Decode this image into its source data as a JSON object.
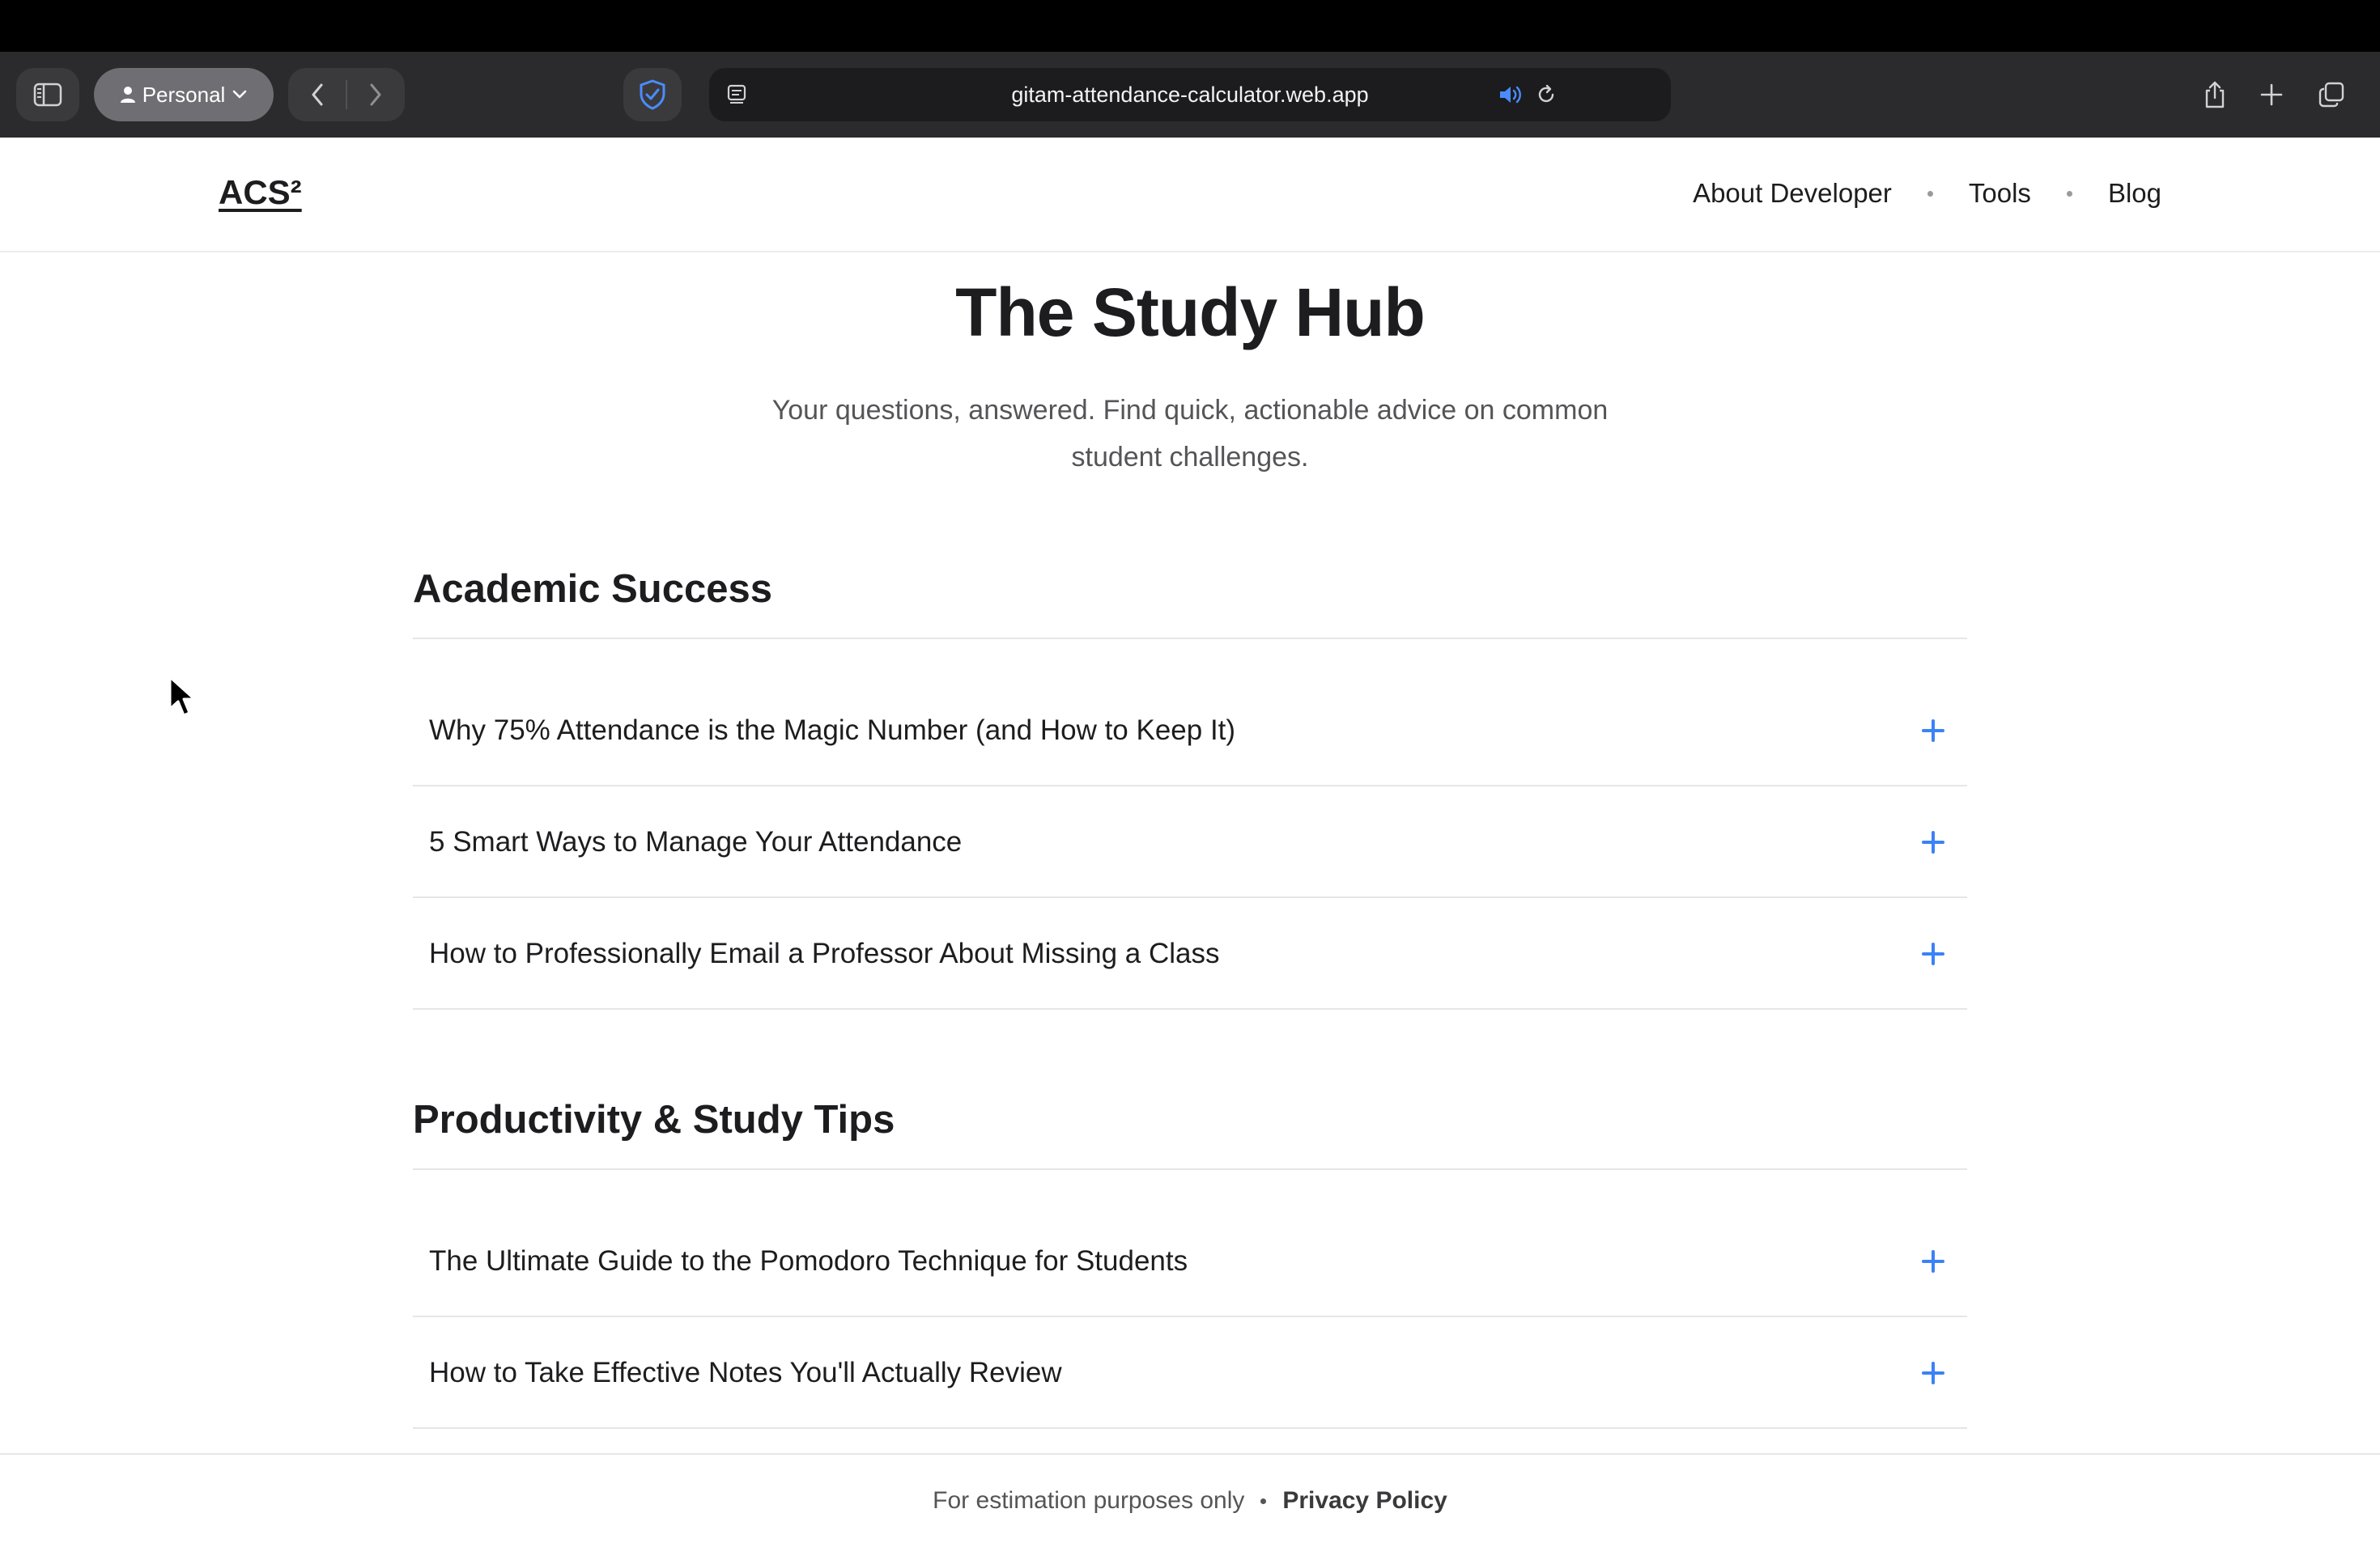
{
  "browser": {
    "profile_label": "Personal",
    "url": "gitam-attendance-calculator.web.app",
    "icons": [
      "sidebar-icon",
      "person-icon",
      "chevron-down-icon",
      "back-icon",
      "forward-icon",
      "shield-icon",
      "reader-icon",
      "audio-icon",
      "reload-icon",
      "share-icon",
      "new-tab-icon",
      "tab-overview-icon"
    ],
    "accent_color": "#3b82f6"
  },
  "site": {
    "logo": "ACS²",
    "nav": [
      {
        "label": "About Developer"
      },
      {
        "label": "Tools"
      },
      {
        "label": "Blog"
      }
    ]
  },
  "hero": {
    "title": "The Study Hub",
    "subtitle_line1": "Your questions, answered. Find quick, actionable advice on common",
    "subtitle_line2": "student challenges."
  },
  "sections": [
    {
      "title": "Academic Success",
      "items": [
        {
          "question": "Why 75% Attendance is the Magic Number (and How to Keep It)"
        },
        {
          "question": "5 Smart Ways to Manage Your Attendance"
        },
        {
          "question": "How to Professionally Email a Professor About Missing a Class"
        }
      ]
    },
    {
      "title": "Productivity & Study Tips",
      "items": [
        {
          "question": "The Ultimate Guide to the Pomodoro Technique for Students"
        },
        {
          "question": "How to Take Effective Notes You'll Actually Review"
        }
      ]
    }
  ],
  "footer": {
    "disclaimer": "For estimation purposes only",
    "privacy_label": "Privacy Policy"
  }
}
